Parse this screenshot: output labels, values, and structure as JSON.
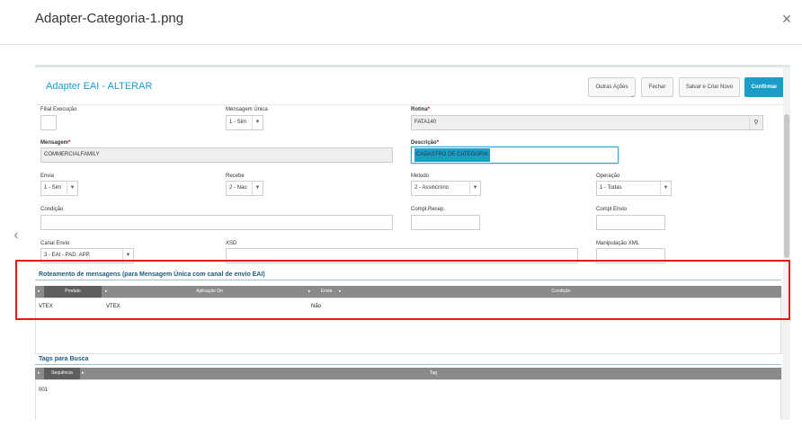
{
  "viewer": {
    "title": "Adapter-Categoria-1.png",
    "close_icon": "×",
    "prev_icon": "‹"
  },
  "form": {
    "title": "Adapter EAI - ALTERAR",
    "buttons": {
      "other_actions": "Outras Ações",
      "close": "Fechar",
      "save_new": "Salvar e Criar Novo",
      "confirm": "Confirmar"
    },
    "fields": {
      "filial_label": "Filial Execução",
      "msg_unica_label": "Mensagem Única",
      "msg_unica_value": "1 - Sim",
      "rotina_label": "Rotina",
      "rotina_value": "FATA140",
      "mensagem_label": "Mensagem",
      "mensagem_value": "COMMERCIALFAMILY",
      "descricao_label": "Descrição",
      "descricao_value": "CADASTRO DE CATEGORIA",
      "envia_label": "Envia",
      "envia_value": "1 - Sim",
      "recebe_label": "Recebe",
      "recebe_value": "2 - Nao",
      "metodo_label": "Metodo",
      "metodo_value": "2 - Assincrono",
      "operacao_label": "Operação",
      "operacao_value": "1 - Todas",
      "condicao_label": "Condição",
      "compl_recep_label": "Compl.Recep.",
      "compl_envio_label": "Compl.Envio",
      "canal_envio_label": "Canal Envio",
      "canal_envio_value": "3 - EAI - PAD. APP.",
      "xsd_label": "XSD",
      "manip_xml_label": "Manipulação XML"
    },
    "required_mark": "*",
    "routing": {
      "title": "Roteamento de mensagens (para Mensagem Única com canal de envio EAI)",
      "columns": [
        "Produto",
        "Aplicação On",
        "Envia",
        "Condição"
      ],
      "rows": [
        {
          "produto": "VTEX",
          "aplicacao": "VTEX",
          "envia": "Não",
          "condicao": ""
        }
      ]
    },
    "tags": {
      "title": "Tags para Busca",
      "columns": [
        "Sequência",
        "Tag"
      ],
      "rows": [
        {
          "sequencia": "001",
          "tag": ""
        }
      ]
    }
  },
  "colors": {
    "accent": "#1a9ec9",
    "annotation": "#e41b1b",
    "section_title": "#1b5a82"
  }
}
